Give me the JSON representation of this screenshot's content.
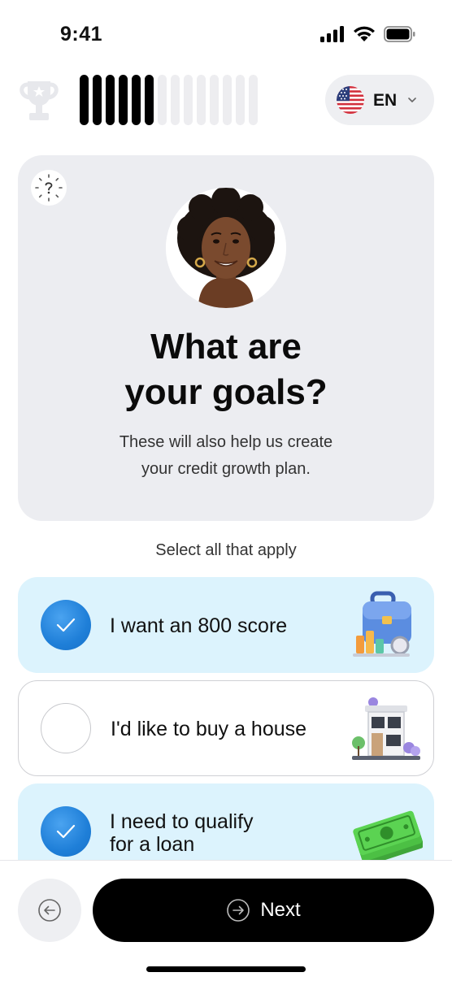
{
  "status_bar": {
    "time": "9:41"
  },
  "progress": {
    "steps_total": 14,
    "steps_completed": 6
  },
  "language": {
    "code": "EN",
    "flag": "us-flag-icon"
  },
  "hero": {
    "title": "What are\nyour goals?",
    "subtitle": "These will also help us create\nyour credit growth plan.",
    "help_icon": "question-sparkle-icon"
  },
  "select_hint": "Select all that apply",
  "options": [
    {
      "label": "I want an 800 score",
      "selected": true,
      "illustration": "briefcase-chart-icon"
    },
    {
      "label": "I'd like to buy a house",
      "selected": false,
      "illustration": "house-icon"
    },
    {
      "label": "I need to qualify\nfor a loan",
      "selected": true,
      "illustration": "cash-stack-icon"
    }
  ],
  "footer": {
    "next_label": "Next",
    "back_icon": "arrow-left-circle-icon",
    "next_icon": "arrow-right-circle-icon"
  },
  "colors": {
    "accent": "#1f7fd8",
    "selected_bg": "#dcf3fd",
    "card_bg": "#ecedf1",
    "button_bg": "#000000"
  }
}
